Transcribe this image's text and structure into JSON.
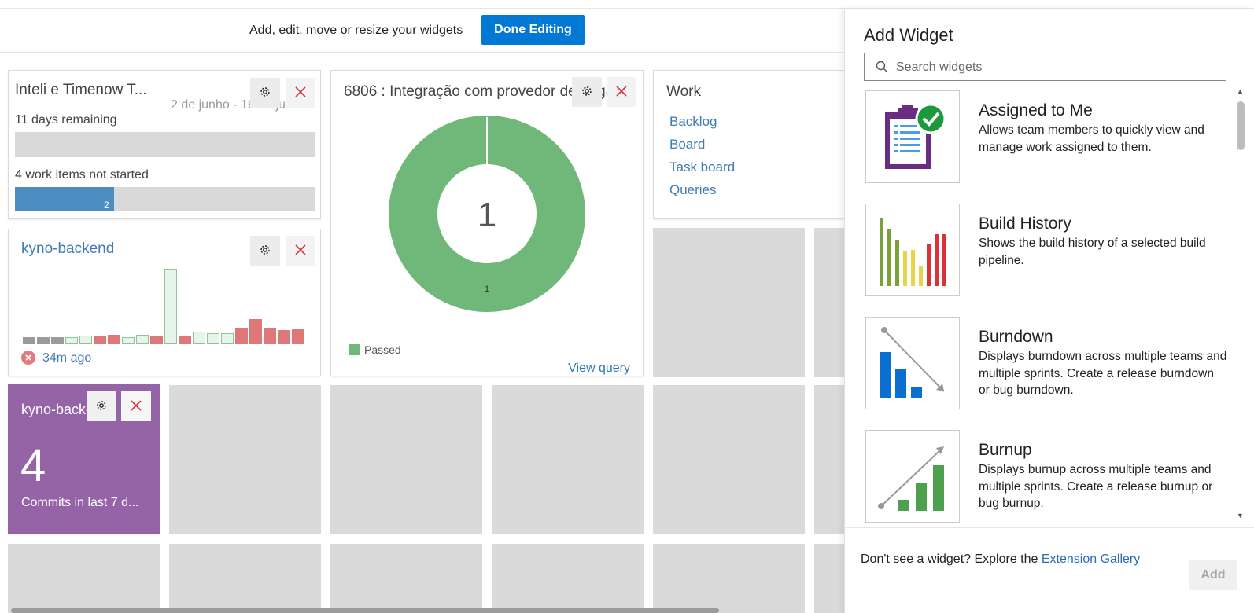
{
  "edit_bar": {
    "message": "Add, edit, move or resize your widgets",
    "done_label": "Done Editing"
  },
  "sprint_widget": {
    "title": "Inteli e Timenow T...",
    "dates": "2 de junho - 16 de junho",
    "days_remaining": "11 days remaining",
    "days_progress": 0,
    "not_started": "4 work items not started",
    "not_started_progress": 0.33,
    "not_started_bar_label": "2"
  },
  "query_widget": {
    "title": "6806 : Integração com provedor de pagamento",
    "center_value": "1",
    "segment_label": "1",
    "legend": "Passed",
    "legend_color": "#6fb87a",
    "link": "View query"
  },
  "work_widget": {
    "title": "Work",
    "links": [
      "Backlog",
      "Board",
      "Task board",
      "Queries"
    ]
  },
  "build_widget": {
    "title": "kyno-backend",
    "status_time": "34m ago",
    "status": "failed",
    "bars": [
      {
        "value": 8,
        "status": "none"
      },
      {
        "value": 8,
        "status": "none"
      },
      {
        "value": 8,
        "status": "none"
      },
      {
        "value": 8,
        "status": "success"
      },
      {
        "value": 10,
        "status": "success"
      },
      {
        "value": 10,
        "status": "failed"
      },
      {
        "value": 11,
        "status": "failed"
      },
      {
        "value": 8,
        "status": "success"
      },
      {
        "value": 11,
        "status": "success"
      },
      {
        "value": 9,
        "status": "failed"
      },
      {
        "value": 90,
        "status": "success"
      },
      {
        "value": 9,
        "status": "failed"
      },
      {
        "value": 15,
        "status": "success"
      },
      {
        "value": 13,
        "status": "success"
      },
      {
        "value": 13,
        "status": "success"
      },
      {
        "value": 20,
        "status": "failed"
      },
      {
        "value": 30,
        "status": "failed"
      },
      {
        "value": 20,
        "status": "failed"
      },
      {
        "value": 17,
        "status": "failed"
      },
      {
        "value": 18,
        "status": "failed"
      }
    ]
  },
  "commits_widget": {
    "title": "kyno-backend",
    "value": "4",
    "label": "Commits in last 7 d...",
    "color": "#9564a6"
  },
  "panel": {
    "title": "Add Widget",
    "search_placeholder": "Search widgets",
    "widgets": [
      {
        "name": "Assigned to Me",
        "description": "Allows team members to quickly view and manage work assigned to them.",
        "icon": "clipboard-check-icon"
      },
      {
        "name": "Build History",
        "description": "Shows the build history of a selected build pipeline.",
        "icon": "build-history-icon"
      },
      {
        "name": "Burndown",
        "description": "Displays burndown across multiple teams and multiple sprints. Create a release burndown or bug burndown.",
        "icon": "burndown-icon"
      },
      {
        "name": "Burnup",
        "description": "Displays burnup across multiple teams and multiple sprints. Create a release burnup or bug burnup.",
        "icon": "burnup-icon"
      }
    ],
    "footer_text": "Don't see a widget? Explore the ",
    "footer_link": "Extension Gallery",
    "add_label": "Add"
  }
}
